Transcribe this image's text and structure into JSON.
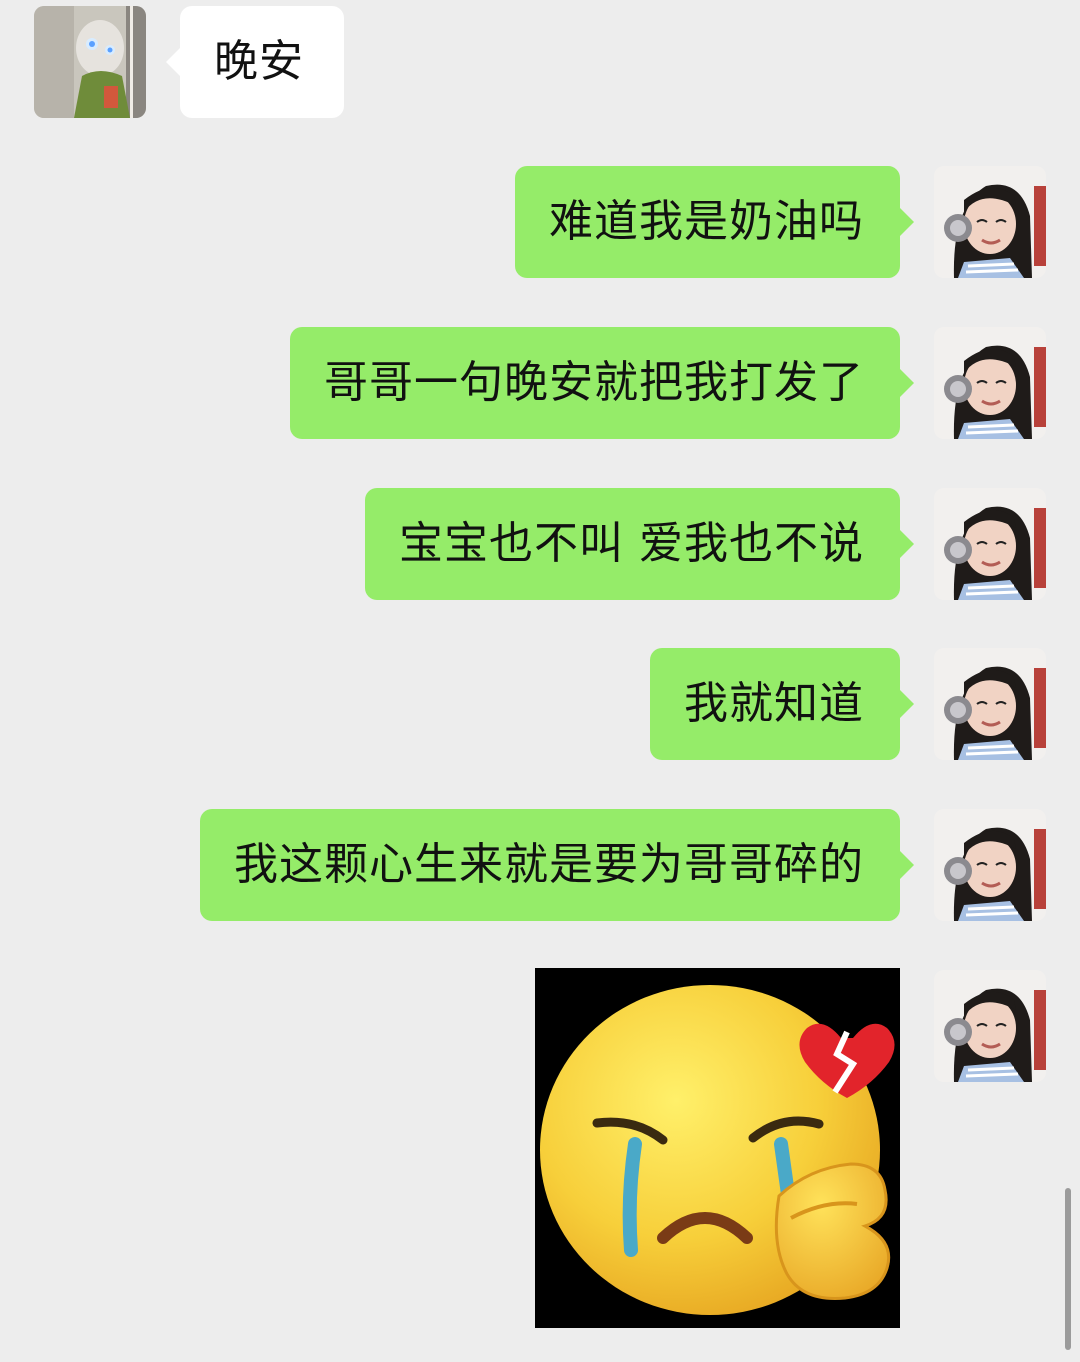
{
  "chat": {
    "incoming": [
      {
        "text": "晚安",
        "avatar_icon": "masked-figure-avatar-icon"
      }
    ],
    "outgoing": [
      {
        "text": "难道我是奶油吗"
      },
      {
        "text": "哥哥一句晚安就把我打发了"
      },
      {
        "text": "宝宝也不叫 爱我也不说"
      },
      {
        "text": "我就知道"
      },
      {
        "text": "我这颗心生来就是要为哥哥碎的"
      }
    ],
    "sticker": {
      "icon": "crying-heartbroken-emoji-icon"
    },
    "self_avatar_icon": "girl-with-headphones-avatar-icon"
  },
  "colors": {
    "background": "#ededed",
    "outgoing_bubble": "#95ec69",
    "incoming_bubble": "#ffffff"
  }
}
